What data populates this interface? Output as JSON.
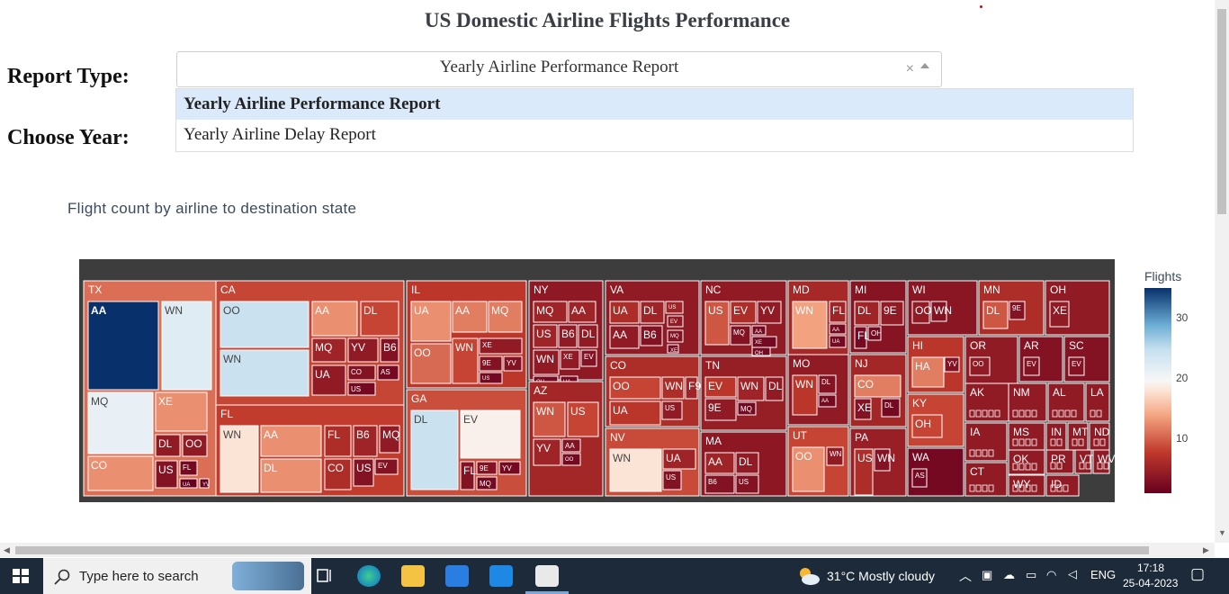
{
  "page": {
    "title": "US Domestic Airline Flights Performance",
    "report_type_label": "Report Type:",
    "choose_year_label": "Choose Year:",
    "selected_report": "Yearly Airline Performance Report",
    "clear_symbol": "×",
    "dropdown_options": [
      "Yearly Airline Performance Report",
      "Yearly Airline Delay Report"
    ]
  },
  "chart_data": {
    "type": "treemap",
    "title": "Flight count by airline to destination state",
    "colorbar": {
      "title": "Flights",
      "ticks": [
        30,
        20,
        10
      ],
      "range": [
        2,
        34
      ],
      "colorscale": "RdBu"
    },
    "groups": [
      {
        "state": "TX",
        "airlines": [
          {
            "name": "AA",
            "flights": 34
          },
          {
            "name": "WN",
            "flights": 22
          },
          {
            "name": "MQ",
            "flights": 21
          },
          {
            "name": "XE",
            "flights": 13
          },
          {
            "name": "CO",
            "flights": 13
          },
          {
            "name": "DL",
            "flights": 5
          },
          {
            "name": "OO",
            "flights": 5
          },
          {
            "name": "US",
            "flights": 4
          },
          {
            "name": "FL",
            "flights": 3
          },
          {
            "name": "UA",
            "flights": 2
          },
          {
            "name": "YV",
            "flights": 2
          }
        ]
      },
      {
        "state": "CA",
        "airlines": [
          {
            "name": "OO",
            "flights": 24
          },
          {
            "name": "WN",
            "flights": 24
          },
          {
            "name": "AA",
            "flights": 13
          },
          {
            "name": "DL",
            "flights": 9
          },
          {
            "name": "MQ",
            "flights": 6
          },
          {
            "name": "YV",
            "flights": 5
          },
          {
            "name": "B6",
            "flights": 4
          },
          {
            "name": "UA",
            "flights": 5
          },
          {
            "name": "CO",
            "flights": 4
          },
          {
            "name": "AS",
            "flights": 3
          },
          {
            "name": "US",
            "flights": 3
          }
        ]
      },
      {
        "state": "FL",
        "airlines": [
          {
            "name": "WN",
            "flights": 18
          },
          {
            "name": "AA",
            "flights": 13
          },
          {
            "name": "DL",
            "flights": 13
          },
          {
            "name": "FL",
            "flights": 7
          },
          {
            "name": "B6",
            "flights": 6
          },
          {
            "name": "MQ",
            "flights": 5
          },
          {
            "name": "CO",
            "flights": 7
          },
          {
            "name": "US",
            "flights": 4
          },
          {
            "name": "EV",
            "flights": 4
          }
        ]
      },
      {
        "state": "IL",
        "airlines": [
          {
            "name": "UA",
            "flights": 13
          },
          {
            "name": "AA",
            "flights": 12
          },
          {
            "name": "MQ",
            "flights": 12
          },
          {
            "name": "OO",
            "flights": 11
          },
          {
            "name": "WN",
            "flights": 9
          },
          {
            "name": "XE",
            "flights": 5
          },
          {
            "name": "9E",
            "flights": 4
          },
          {
            "name": "YV",
            "flights": 4
          },
          {
            "name": "US",
            "flights": 3
          }
        ]
      },
      {
        "state": "GA",
        "airlines": [
          {
            "name": "DL",
            "flights": 24
          },
          {
            "name": "EV",
            "flights": 19
          },
          {
            "name": "FL",
            "flights": 4
          },
          {
            "name": "9E",
            "flights": 4
          },
          {
            "name": "YV",
            "flights": 3
          },
          {
            "name": "MQ",
            "flights": 3
          }
        ]
      },
      {
        "state": "NY",
        "airlines": [
          {
            "name": "MQ",
            "flights": 6
          },
          {
            "name": "AA",
            "flights": 6
          },
          {
            "name": "US",
            "flights": 6
          },
          {
            "name": "B6",
            "flights": 5
          },
          {
            "name": "DL",
            "flights": 5
          },
          {
            "name": "WN",
            "flights": 5
          },
          {
            "name": "XE",
            "flights": 5
          },
          {
            "name": "EV",
            "flights": 4
          },
          {
            "name": "OH",
            "flights": 3
          },
          {
            "name": "UA",
            "flights": 3
          }
        ]
      },
      {
        "state": "VA",
        "airlines": [
          {
            "name": "UA",
            "flights": 7
          },
          {
            "name": "DL",
            "flights": 6
          },
          {
            "name": "AA",
            "flights": 5
          },
          {
            "name": "B6",
            "flights": 4
          },
          {
            "name": "US",
            "flights": 6
          },
          {
            "name": "EV",
            "flights": 5
          },
          {
            "name": "MQ",
            "flights": 4
          },
          {
            "name": "XE",
            "flights": 3
          }
        ]
      },
      {
        "state": "CO",
        "airlines": [
          {
            "name": "OO",
            "flights": 9
          },
          {
            "name": "WN",
            "flights": 7
          },
          {
            "name": "F9",
            "flights": 6
          },
          {
            "name": "UA",
            "flights": 8
          },
          {
            "name": "US",
            "flights": 5
          }
        ]
      },
      {
        "state": "AZ",
        "airlines": [
          {
            "name": "WN",
            "flights": 10
          },
          {
            "name": "US",
            "flights": 9
          },
          {
            "name": "YV",
            "flights": 6
          },
          {
            "name": "AA",
            "flights": 4
          },
          {
            "name": "OO",
            "flights": 3
          }
        ]
      },
      {
        "state": "NV",
        "airlines": [
          {
            "name": "WN",
            "flights": 18
          },
          {
            "name": "UA",
            "flights": 6
          },
          {
            "name": "US",
            "flights": 4
          }
        ]
      },
      {
        "state": "NC",
        "airlines": [
          {
            "name": "US",
            "flights": 10
          },
          {
            "name": "EV",
            "flights": 7
          },
          {
            "name": "YV",
            "flights": 5
          },
          {
            "name": "MQ",
            "flights": 4
          },
          {
            "name": "AA",
            "flights": 3
          },
          {
            "name": "XE",
            "flights": 3
          },
          {
            "name": "OH",
            "flights": 3
          }
        ]
      },
      {
        "state": "TN",
        "airlines": [
          {
            "name": "EV",
            "flights": 8
          },
          {
            "name": "WN",
            "flights": 6
          },
          {
            "name": "DL",
            "flights": 5
          },
          {
            "name": "9E",
            "flights": 5
          },
          {
            "name": "MQ",
            "flights": 3
          }
        ]
      },
      {
        "state": "MA",
        "airlines": [
          {
            "name": "AA",
            "flights": 6
          },
          {
            "name": "DL",
            "flights": 5
          },
          {
            "name": "B6",
            "flights": 4
          },
          {
            "name": "US",
            "flights": 4
          }
        ]
      },
      {
        "state": "MD",
        "airlines": [
          {
            "name": "WN",
            "flights": 14
          },
          {
            "name": "FL",
            "flights": 6
          },
          {
            "name": "AA",
            "flights": 3
          },
          {
            "name": "UA",
            "flights": 3
          }
        ]
      },
      {
        "state": "MO",
        "airlines": [
          {
            "name": "WN",
            "flights": 8
          },
          {
            "name": "DL",
            "flights": 4
          },
          {
            "name": "AA",
            "flights": 3
          }
        ]
      },
      {
        "state": "UT",
        "airlines": [
          {
            "name": "OO",
            "flights": 13
          },
          {
            "name": "WN",
            "flights": 5
          }
        ]
      },
      {
        "state": "MI",
        "airlines": [
          {
            "name": "DL",
            "flights": 6
          },
          {
            "name": "9E",
            "flights": 5
          },
          {
            "name": "FL",
            "flights": 3
          },
          {
            "name": "OH",
            "flights": 3
          }
        ]
      },
      {
        "state": "NJ",
        "airlines": [
          {
            "name": "CO",
            "flights": 12
          },
          {
            "name": "XE",
            "flights": 4
          },
          {
            "name": "DL",
            "flights": 3
          }
        ]
      },
      {
        "state": "PA",
        "airlines": [
          {
            "name": "US",
            "flights": 7
          },
          {
            "name": "WN",
            "flights": 4
          }
        ]
      },
      {
        "state": "WI",
        "airlines": [
          {
            "name": "OO",
            "flights": 5
          },
          {
            "name": "WN",
            "flights": 4
          }
        ]
      },
      {
        "state": "MN",
        "airlines": [
          {
            "name": "DL",
            "flights": 10
          },
          {
            "name": "9E",
            "flights": 4
          }
        ]
      },
      {
        "state": "OH",
        "airlines": [
          {
            "name": "XE",
            "flights": 5
          }
        ]
      },
      {
        "state": "HI",
        "airlines": [
          {
            "name": "HA",
            "flights": 12
          },
          {
            "name": "YV",
            "flights": 4
          }
        ]
      },
      {
        "state": "OR",
        "airlines": [
          {
            "name": "OO",
            "flights": 5
          }
        ]
      },
      {
        "state": "AR",
        "airlines": [
          {
            "name": "EV",
            "flights": 4
          }
        ]
      },
      {
        "state": "SC",
        "airlines": [
          {
            "name": "EV",
            "flights": 4
          }
        ]
      },
      {
        "state": "KY",
        "airlines": [
          {
            "name": "OH",
            "flights": 9
          }
        ]
      },
      {
        "state": "AK",
        "airlines": []
      },
      {
        "state": "NM",
        "airlines": []
      },
      {
        "state": "AL",
        "airlines": []
      },
      {
        "state": "LA",
        "airlines": []
      },
      {
        "state": "IA",
        "airlines": []
      },
      {
        "state": "MS",
        "airlines": []
      },
      {
        "state": "IN",
        "airlines": []
      },
      {
        "state": "MT",
        "airlines": []
      },
      {
        "state": "ND",
        "airlines": []
      },
      {
        "state": "WA",
        "airlines": [
          {
            "name": "AS",
            "flights": 3
          }
        ]
      },
      {
        "state": "CT",
        "airlines": []
      },
      {
        "state": "OK",
        "airlines": []
      },
      {
        "state": "PR",
        "airlines": []
      },
      {
        "state": "VT",
        "airlines": []
      },
      {
        "state": "WV",
        "airlines": []
      },
      {
        "state": "WY",
        "airlines": []
      },
      {
        "state": "ID",
        "airlines": []
      }
    ]
  },
  "taskbar": {
    "search_placeholder": "Type here to search",
    "weather": "31°C  Mostly cloudy",
    "language": "ENG",
    "time": "17:18",
    "date": "25-04-2023"
  }
}
